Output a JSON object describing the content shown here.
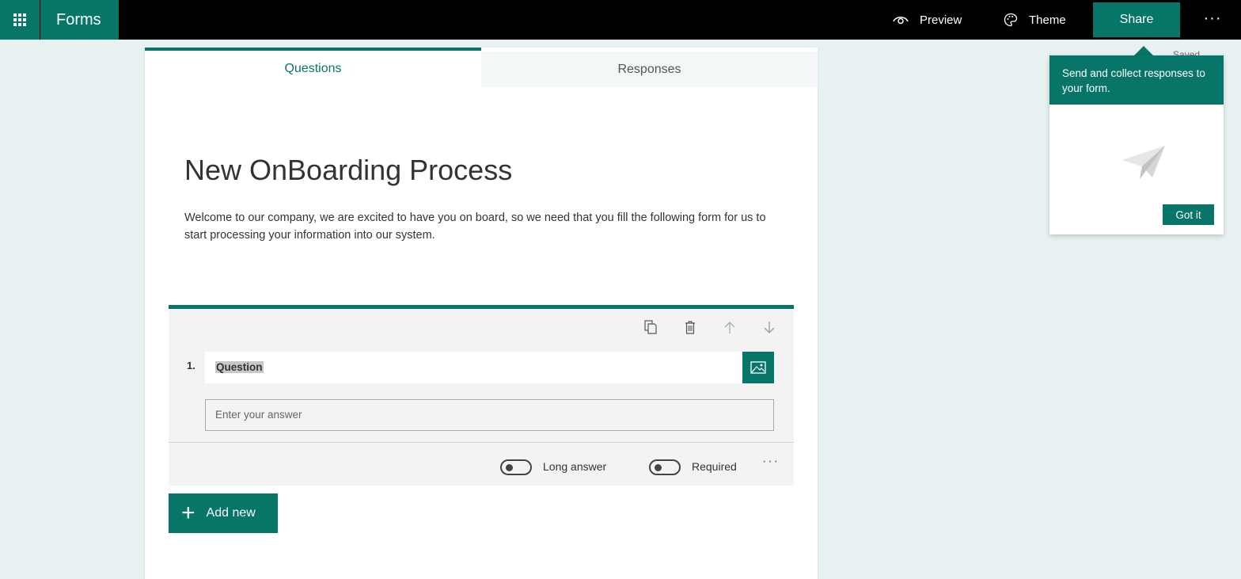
{
  "topbar": {
    "app_name": "Forms",
    "preview_label": "Preview",
    "theme_label": "Theme",
    "share_label": "Share",
    "more_label": "···"
  },
  "status": {
    "saved": "Saved"
  },
  "tabs": [
    {
      "label": "Questions",
      "selected": true
    },
    {
      "label": "Responses",
      "selected": false
    }
  ],
  "form": {
    "title": "New OnBoarding Process",
    "description": "Welcome to our company, we are excited to have you on board, so we need that you fill the following form for us to start processing your information into our system."
  },
  "question": {
    "number": "1.",
    "text": "Question",
    "answer_placeholder": "Enter your answer",
    "long_answer_label": "Long answer",
    "long_answer_on": false,
    "required_label": "Required",
    "required_on": false,
    "more_label": "···",
    "toolbar_icons": [
      "copy-icon",
      "delete-icon",
      "arrow-up-icon",
      "arrow-down-icon"
    ]
  },
  "add_new": {
    "plus": "+",
    "label": "Add new"
  },
  "callout": {
    "message": "Send and collect responses to your form.",
    "button_label": "Got it"
  },
  "colors": {
    "accent": "#077568",
    "background": "#e8f1f2",
    "topbar": "#000000"
  }
}
